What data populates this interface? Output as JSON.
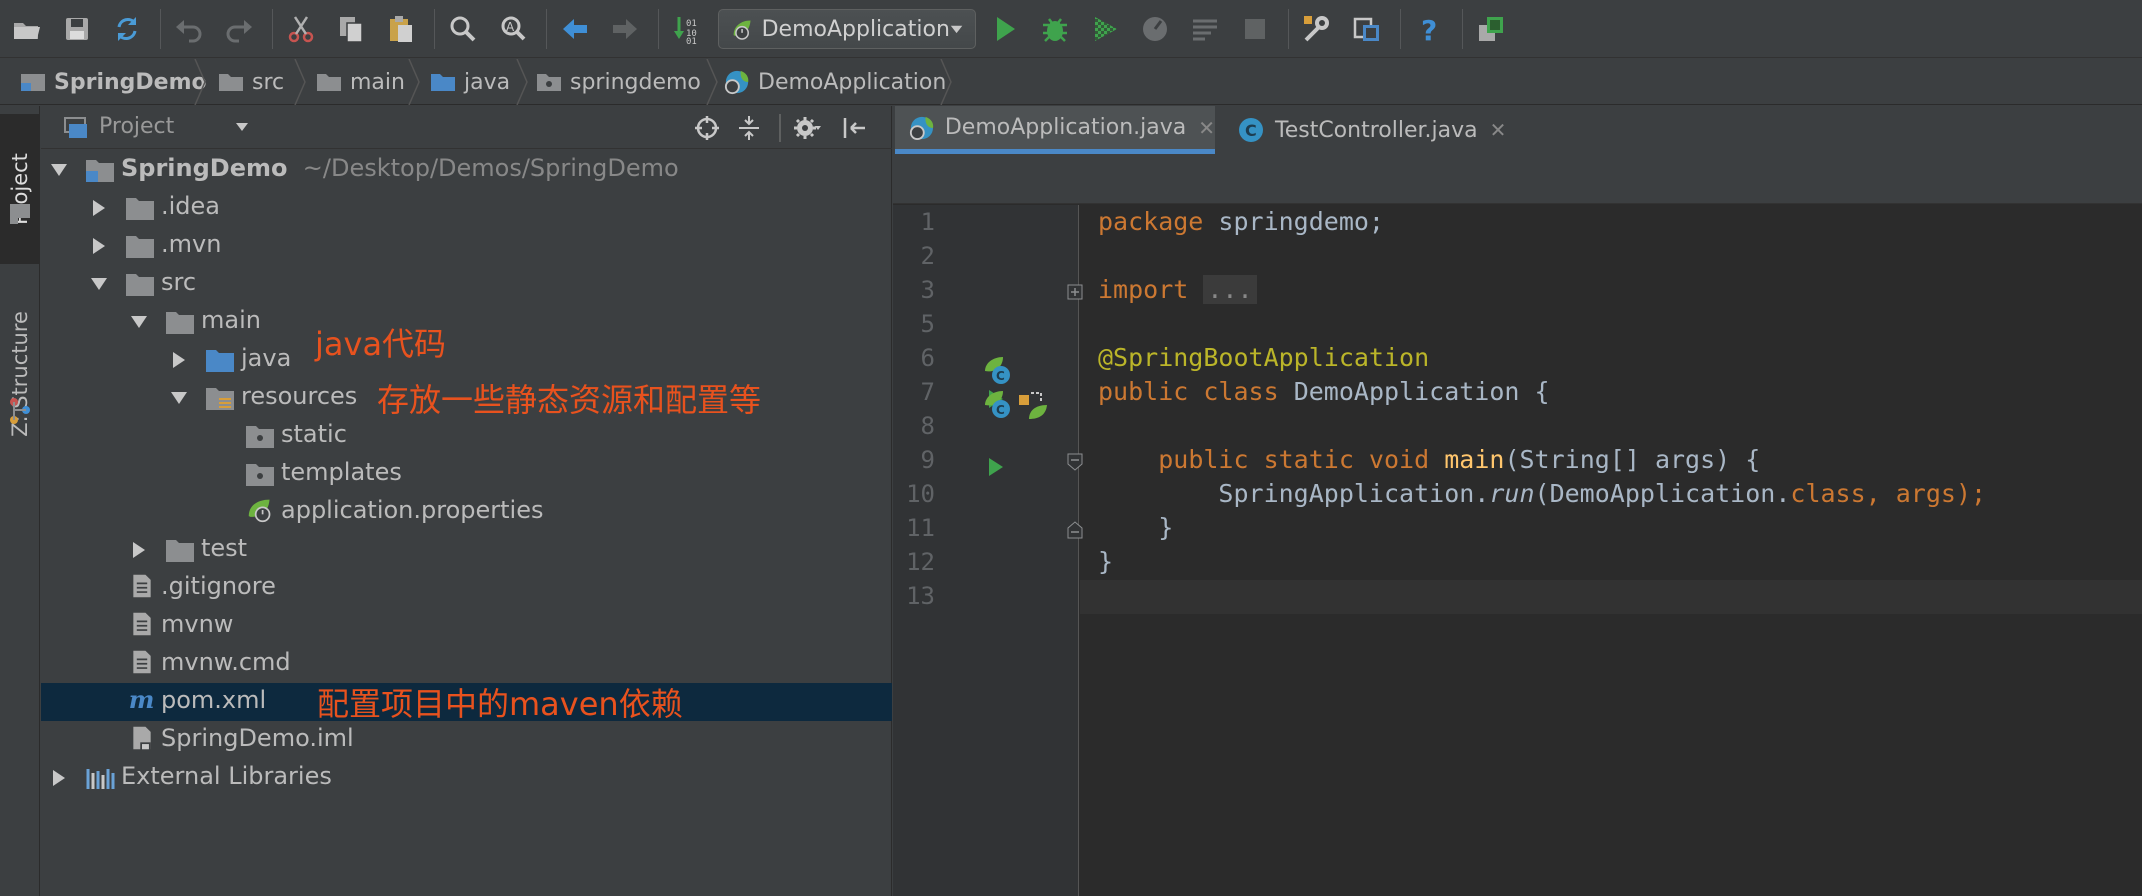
{
  "toolbar": {
    "run_config_label": "DemoApplication",
    "icons": [
      "open-folder-icon",
      "save-icon",
      "sync-icon",
      "undo-icon",
      "redo-icon",
      "cut-icon",
      "copy-icon",
      "paste-icon",
      "find-icon",
      "replace-icon",
      "back-icon",
      "forward-icon",
      "build-icon",
      "run-config-icon",
      "run-icon",
      "debug-icon",
      "coverage-icon",
      "profile-icon",
      "build-artifacts-icon",
      "stop-icon",
      "settings-icon",
      "project-structure-icon",
      "help-icon",
      "sdk-icon"
    ]
  },
  "breadcrumb": [
    "SpringDemo",
    "src",
    "main",
    "java",
    "springdemo",
    "DemoApplication"
  ],
  "left_strip": {
    "project_tab": "Project",
    "structure_tab": "Z: Structure"
  },
  "project_panel": {
    "title": "Project",
    "tree": [
      {
        "label": "SpringDemo",
        "path": "~/Desktop/Demos/SpringDemo"
      },
      {
        "label": ".idea"
      },
      {
        "label": ".mvn"
      },
      {
        "label": "src"
      },
      {
        "label": "main"
      },
      {
        "label": "java"
      },
      {
        "label": "resources"
      },
      {
        "label": "static"
      },
      {
        "label": "templates"
      },
      {
        "label": "application.properties"
      },
      {
        "label": "test"
      },
      {
        "label": ".gitignore"
      },
      {
        "label": "mvnw"
      },
      {
        "label": "mvnw.cmd"
      },
      {
        "label": "pom.xml"
      },
      {
        "label": "SpringDemo.iml"
      },
      {
        "label": "External Libraries"
      }
    ],
    "annotations": {
      "java": "java代码",
      "resources": "存放一些静态资源和配置等",
      "pom": "配置项目中的maven依赖"
    }
  },
  "editor": {
    "tabs": [
      {
        "label": "DemoApplication.java",
        "active": true
      },
      {
        "label": "TestController.java",
        "active": false
      }
    ],
    "line_numbers": [
      "1",
      "2",
      "3",
      "5",
      "6",
      "7",
      "8",
      "9",
      "10",
      "11",
      "12",
      "13"
    ],
    "code": {
      "l1_kw": "package",
      "l1_rest": " springdemo;",
      "l3_kw": "import",
      "l3_fold": "...",
      "l6": "@SpringBootApplication",
      "l7_kw1": "public",
      "l7_kw2": "class",
      "l7_rest": " DemoApplication {",
      "l9_kw": "public static void",
      "l9_fn": "main",
      "l9_rest": "(String[] args) {",
      "l10_a": "SpringApplication.",
      "l10_run": "run",
      "l10_b": "(DemoApplication.",
      "l10_kw": "class",
      "l10_c": ", args);",
      "l11": "}",
      "l12": "}"
    }
  },
  "colors": {
    "background": "#3c3f41",
    "editor_bg": "#2b2b2b",
    "keyword": "#cc7832",
    "annotation": "#bbb529",
    "function": "#ffc66d",
    "selection": "#0d293e",
    "annotation_text": "#e8521e"
  }
}
